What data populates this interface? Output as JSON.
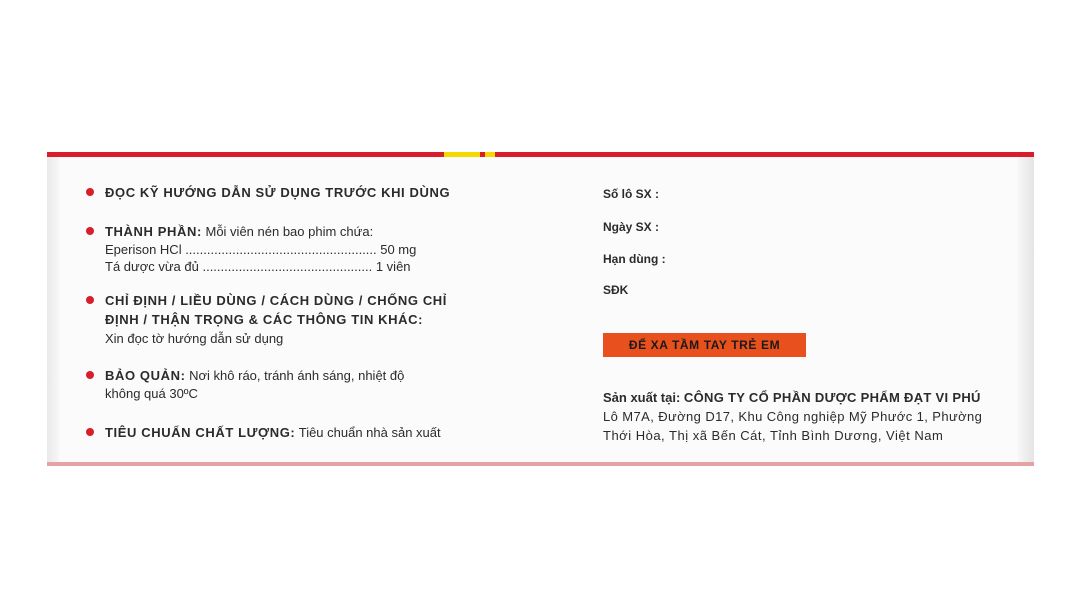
{
  "left": {
    "read_instructions": "ĐỌC KỸ HƯỚNG DẪN SỬ DỤNG TRƯỚC KHI DÙNG",
    "composition_label": "THÀNH PHẦN:",
    "composition_text": "Mỗi viên nén bao phim chứa:",
    "ingredient_1": "Eperison HCl ..................................................... 50 mg",
    "ingredient_2": "Tá dược vừa đủ ............................................... 1 viên",
    "indications_line1": "CHỈ ĐỊNH / LIỀU DÙNG / CÁCH DÙNG / CHỐNG CHỈ",
    "indications_line2": "ĐỊNH / THẬN TRỌNG & CÁC THÔNG TIN KHÁC:",
    "indications_text": "Xin đọc tờ hướng dẫn sử dụng",
    "storage_label": "BẢO QUẢN:",
    "storage_line1": "Nơi khô ráo, tránh ánh sáng, nhiệt độ",
    "storage_line2": "không quá 30ºC",
    "standard_label": "TIÊU CHUẨN CHẤT LƯỢNG:",
    "standard_text": "Tiêu chuẩn nhà sản xuất"
  },
  "right": {
    "batch_label": "Số lô SX  :",
    "mfg_date_label": "Ngày SX   :",
    "expiry_label": "Hạn dùng :",
    "reg_label": "SĐK",
    "warning_badge": "ĐỂ XA TẦM TAY TRẺ EM",
    "manufacturer_label": "Sản xuất tại:",
    "manufacturer_name": "CÔNG TY CỔ PHẦN DƯỢC PHẨM ĐẠT VI PHÚ",
    "address_line1": "Lô M7A, Đường D17, Khu Công nghiệp Mỹ Phước 1, Phường",
    "address_line2": "Thới Hòa, Thị xã Bến Cát, Tỉnh Bình Dương, Việt Nam"
  },
  "colors": {
    "accent_red": "#d81e2c",
    "accent_yellow": "#f5d800",
    "badge_orange": "#e8501e"
  }
}
